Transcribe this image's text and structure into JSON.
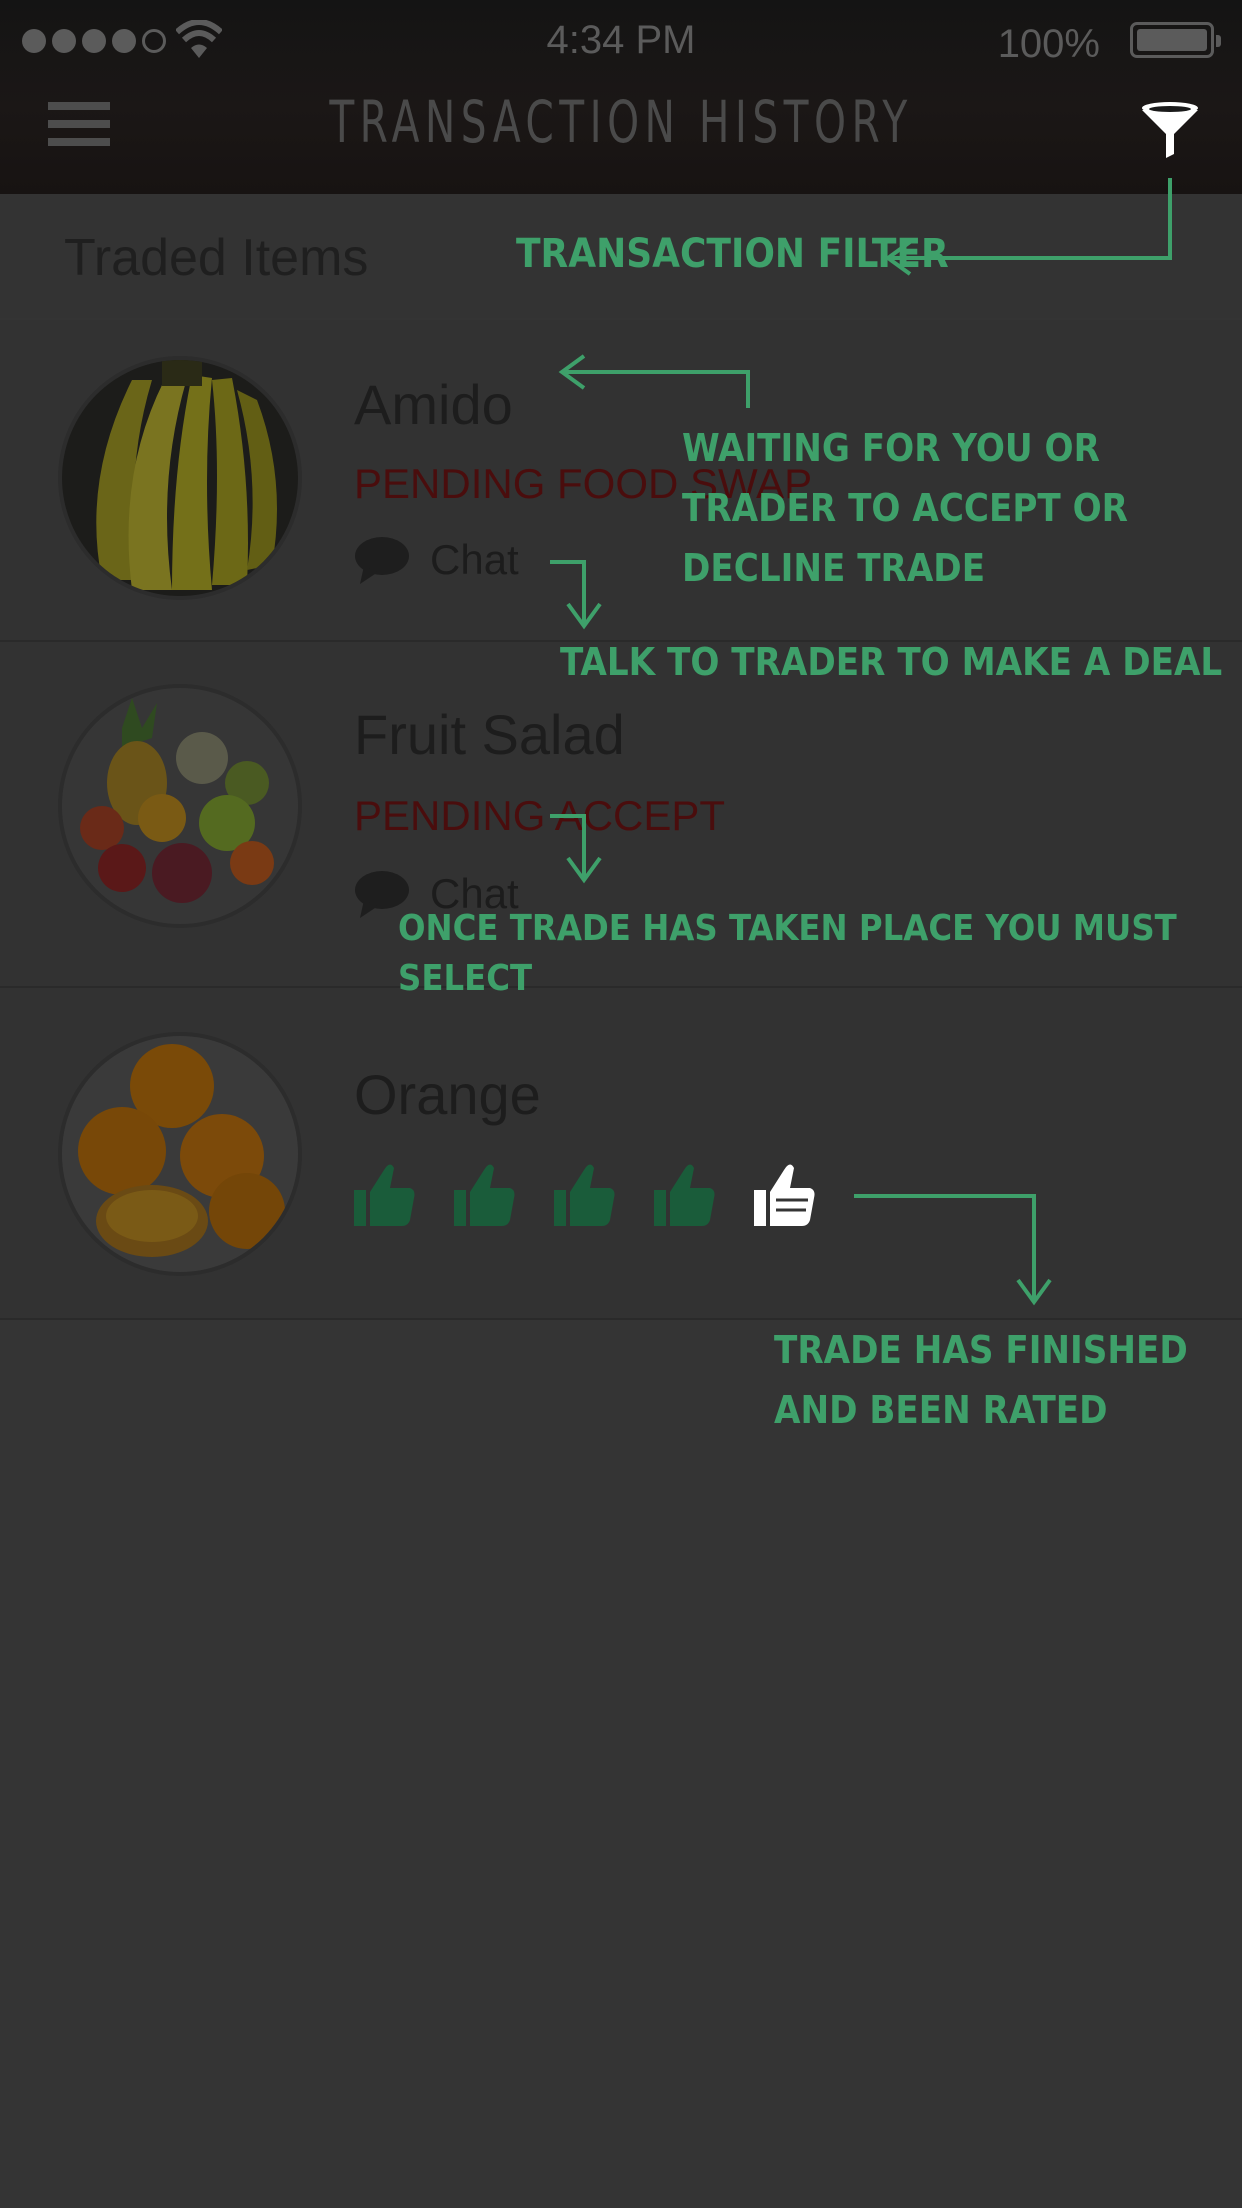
{
  "status_bar": {
    "time": "4:34 PM",
    "battery": "100%"
  },
  "header": {
    "title": "TRANSACTION HISTORY"
  },
  "section": {
    "title": "Traded Items"
  },
  "items": [
    {
      "name": "Amido",
      "status": "PENDING FOOD SWAP",
      "chat_label": "Chat",
      "image": "bananas"
    },
    {
      "name": "Fruit Salad",
      "status": "PENDING ACCEPT",
      "chat_label": "Chat",
      "image": "fruit-salad"
    },
    {
      "name": "Orange",
      "rating": 4,
      "rating_max": 5,
      "image": "oranges"
    }
  ],
  "annotations": {
    "filter": "TRANSACTION FILTER",
    "pending": "WAITING FOR YOU OR TRADER TO ACCEPT OR DECLINE TRADE",
    "chat": "TALK TO TRADER TO MAKE A DEAL",
    "select": "ONCE TRADE HAS TAKEN PLACE YOU MUST SELECT",
    "rated": "TRADE HAS FINISHED AND BEEN RATED"
  },
  "colors": {
    "annotation": "#3ea06a",
    "status": "#4a0d0d",
    "thumb_active": "#1a5c3a",
    "thumb_inactive": "#ffffff"
  }
}
